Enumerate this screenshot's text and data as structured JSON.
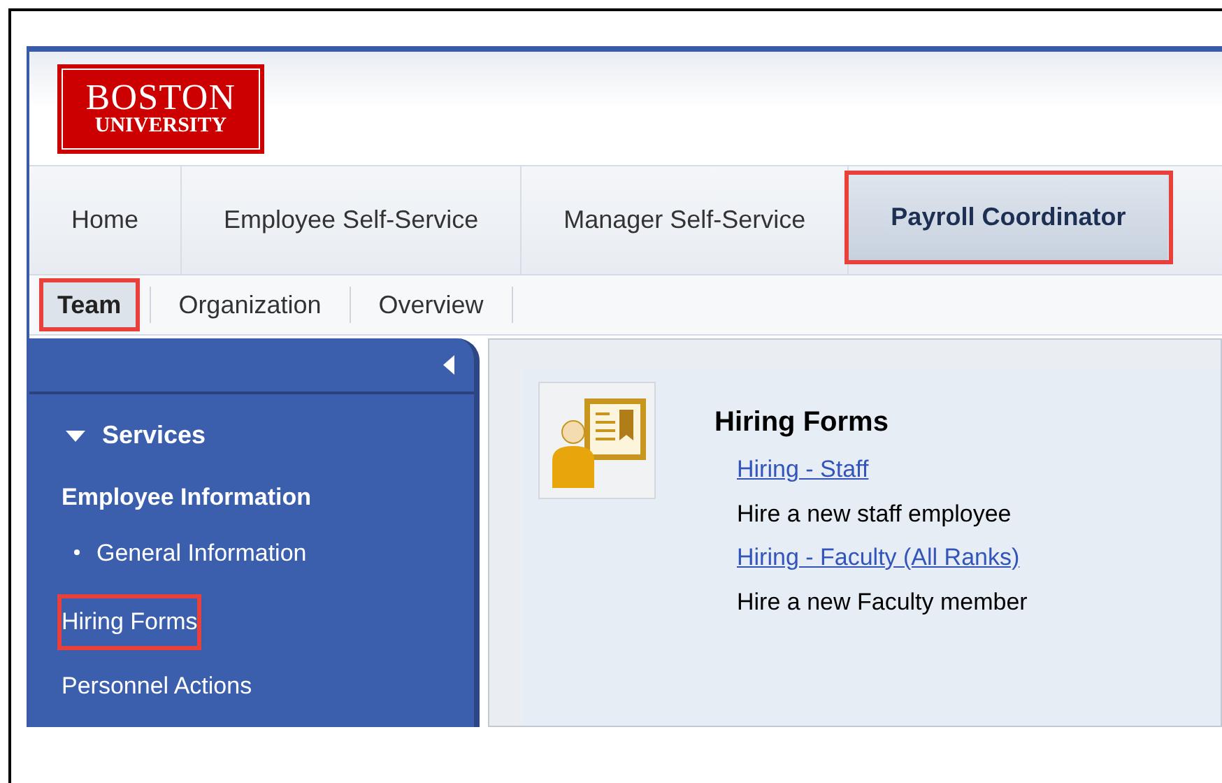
{
  "logo": {
    "line_1": "BOSTON",
    "line_2": "UNIVERSITY"
  },
  "tabs": [
    {
      "label": "Home",
      "selected": false,
      "highlighted": false
    },
    {
      "label": "Employee Self-Service",
      "selected": false,
      "highlighted": false
    },
    {
      "label": "Manager Self-Service",
      "selected": false,
      "highlighted": false
    },
    {
      "label": "Payroll Coordinator",
      "selected": true,
      "highlighted": true
    }
  ],
  "subtabs": [
    {
      "label": "Team",
      "selected": true,
      "highlighted": true
    },
    {
      "label": "Organization",
      "selected": false,
      "highlighted": false
    },
    {
      "label": "Overview",
      "selected": false,
      "highlighted": false
    }
  ],
  "sidebar": {
    "section": "Services",
    "expanded": true,
    "items": [
      {
        "kind": "heading",
        "label": "Employee Information",
        "highlighted": false
      },
      {
        "kind": "bullet",
        "label": "General Information",
        "highlighted": false
      },
      {
        "kind": "link",
        "label": "Hiring Forms",
        "highlighted": true
      },
      {
        "kind": "link",
        "label": "Personnel Actions",
        "highlighted": false
      }
    ]
  },
  "content": {
    "title": "Hiring Forms",
    "links": [
      {
        "label": "Hiring - Staff",
        "description": "Hire a new staff employee"
      },
      {
        "label": "Hiring - Faculty (All Ranks)",
        "description": "Hire a new Faculty member"
      }
    ]
  }
}
